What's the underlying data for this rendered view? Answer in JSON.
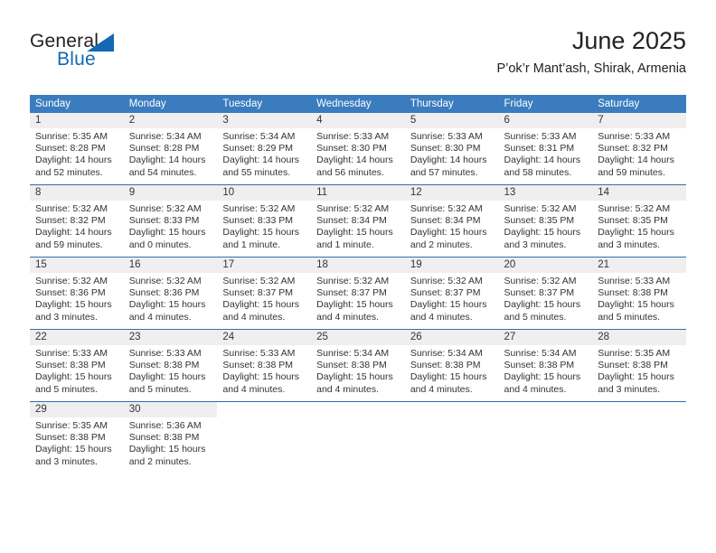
{
  "brand": {
    "word1": "General",
    "word2": "Blue",
    "accent_color": "#1268b3"
  },
  "header": {
    "title": "June 2025",
    "subtitle": "P’ok’r Mant’ash, Shirak, Armenia"
  },
  "theme": {
    "header_blue": "#3b7cbe",
    "row_divider_blue": "#2f6fb0",
    "daynum_band": "#efefef",
    "text": "#333333"
  },
  "weekdays": [
    "Sunday",
    "Monday",
    "Tuesday",
    "Wednesday",
    "Thursday",
    "Friday",
    "Saturday"
  ],
  "weeks": [
    [
      {
        "day": "1",
        "sunrise": "Sunrise: 5:35 AM",
        "sunset": "Sunset: 8:28 PM",
        "daylight": "Daylight: 14 hours and 52 minutes."
      },
      {
        "day": "2",
        "sunrise": "Sunrise: 5:34 AM",
        "sunset": "Sunset: 8:28 PM",
        "daylight": "Daylight: 14 hours and 54 minutes."
      },
      {
        "day": "3",
        "sunrise": "Sunrise: 5:34 AM",
        "sunset": "Sunset: 8:29 PM",
        "daylight": "Daylight: 14 hours and 55 minutes."
      },
      {
        "day": "4",
        "sunrise": "Sunrise: 5:33 AM",
        "sunset": "Sunset: 8:30 PM",
        "daylight": "Daylight: 14 hours and 56 minutes."
      },
      {
        "day": "5",
        "sunrise": "Sunrise: 5:33 AM",
        "sunset": "Sunset: 8:30 PM",
        "daylight": "Daylight: 14 hours and 57 minutes."
      },
      {
        "day": "6",
        "sunrise": "Sunrise: 5:33 AM",
        "sunset": "Sunset: 8:31 PM",
        "daylight": "Daylight: 14 hours and 58 minutes."
      },
      {
        "day": "7",
        "sunrise": "Sunrise: 5:33 AM",
        "sunset": "Sunset: 8:32 PM",
        "daylight": "Daylight: 14 hours and 59 minutes."
      }
    ],
    [
      {
        "day": "8",
        "sunrise": "Sunrise: 5:32 AM",
        "sunset": "Sunset: 8:32 PM",
        "daylight": "Daylight: 14 hours and 59 minutes."
      },
      {
        "day": "9",
        "sunrise": "Sunrise: 5:32 AM",
        "sunset": "Sunset: 8:33 PM",
        "daylight": "Daylight: 15 hours and 0 minutes."
      },
      {
        "day": "10",
        "sunrise": "Sunrise: 5:32 AM",
        "sunset": "Sunset: 8:33 PM",
        "daylight": "Daylight: 15 hours and 1 minute."
      },
      {
        "day": "11",
        "sunrise": "Sunrise: 5:32 AM",
        "sunset": "Sunset: 8:34 PM",
        "daylight": "Daylight: 15 hours and 1 minute."
      },
      {
        "day": "12",
        "sunrise": "Sunrise: 5:32 AM",
        "sunset": "Sunset: 8:34 PM",
        "daylight": "Daylight: 15 hours and 2 minutes."
      },
      {
        "day": "13",
        "sunrise": "Sunrise: 5:32 AM",
        "sunset": "Sunset: 8:35 PM",
        "daylight": "Daylight: 15 hours and 3 minutes."
      },
      {
        "day": "14",
        "sunrise": "Sunrise: 5:32 AM",
        "sunset": "Sunset: 8:35 PM",
        "daylight": "Daylight: 15 hours and 3 minutes."
      }
    ],
    [
      {
        "day": "15",
        "sunrise": "Sunrise: 5:32 AM",
        "sunset": "Sunset: 8:36 PM",
        "daylight": "Daylight: 15 hours and 3 minutes."
      },
      {
        "day": "16",
        "sunrise": "Sunrise: 5:32 AM",
        "sunset": "Sunset: 8:36 PM",
        "daylight": "Daylight: 15 hours and 4 minutes."
      },
      {
        "day": "17",
        "sunrise": "Sunrise: 5:32 AM",
        "sunset": "Sunset: 8:37 PM",
        "daylight": "Daylight: 15 hours and 4 minutes."
      },
      {
        "day": "18",
        "sunrise": "Sunrise: 5:32 AM",
        "sunset": "Sunset: 8:37 PM",
        "daylight": "Daylight: 15 hours and 4 minutes."
      },
      {
        "day": "19",
        "sunrise": "Sunrise: 5:32 AM",
        "sunset": "Sunset: 8:37 PM",
        "daylight": "Daylight: 15 hours and 4 minutes."
      },
      {
        "day": "20",
        "sunrise": "Sunrise: 5:32 AM",
        "sunset": "Sunset: 8:37 PM",
        "daylight": "Daylight: 15 hours and 5 minutes."
      },
      {
        "day": "21",
        "sunrise": "Sunrise: 5:33 AM",
        "sunset": "Sunset: 8:38 PM",
        "daylight": "Daylight: 15 hours and 5 minutes."
      }
    ],
    [
      {
        "day": "22",
        "sunrise": "Sunrise: 5:33 AM",
        "sunset": "Sunset: 8:38 PM",
        "daylight": "Daylight: 15 hours and 5 minutes."
      },
      {
        "day": "23",
        "sunrise": "Sunrise: 5:33 AM",
        "sunset": "Sunset: 8:38 PM",
        "daylight": "Daylight: 15 hours and 5 minutes."
      },
      {
        "day": "24",
        "sunrise": "Sunrise: 5:33 AM",
        "sunset": "Sunset: 8:38 PM",
        "daylight": "Daylight: 15 hours and 4 minutes."
      },
      {
        "day": "25",
        "sunrise": "Sunrise: 5:34 AM",
        "sunset": "Sunset: 8:38 PM",
        "daylight": "Daylight: 15 hours and 4 minutes."
      },
      {
        "day": "26",
        "sunrise": "Sunrise: 5:34 AM",
        "sunset": "Sunset: 8:38 PM",
        "daylight": "Daylight: 15 hours and 4 minutes."
      },
      {
        "day": "27",
        "sunrise": "Sunrise: 5:34 AM",
        "sunset": "Sunset: 8:38 PM",
        "daylight": "Daylight: 15 hours and 4 minutes."
      },
      {
        "day": "28",
        "sunrise": "Sunrise: 5:35 AM",
        "sunset": "Sunset: 8:38 PM",
        "daylight": "Daylight: 15 hours and 3 minutes."
      }
    ],
    [
      {
        "day": "29",
        "sunrise": "Sunrise: 5:35 AM",
        "sunset": "Sunset: 8:38 PM",
        "daylight": "Daylight: 15 hours and 3 minutes."
      },
      {
        "day": "30",
        "sunrise": "Sunrise: 5:36 AM",
        "sunset": "Sunset: 8:38 PM",
        "daylight": "Daylight: 15 hours and 2 minutes."
      },
      {
        "day": "",
        "sunrise": "",
        "sunset": "",
        "daylight": ""
      },
      {
        "day": "",
        "sunrise": "",
        "sunset": "",
        "daylight": ""
      },
      {
        "day": "",
        "sunrise": "",
        "sunset": "",
        "daylight": ""
      },
      {
        "day": "",
        "sunrise": "",
        "sunset": "",
        "daylight": ""
      },
      {
        "day": "",
        "sunrise": "",
        "sunset": "",
        "daylight": ""
      }
    ]
  ]
}
